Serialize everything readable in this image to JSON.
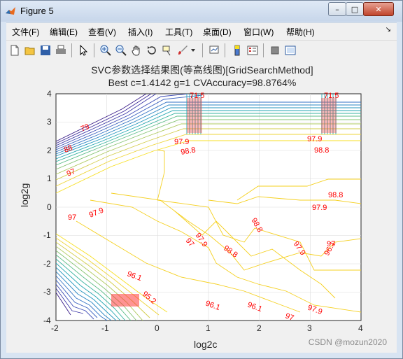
{
  "window": {
    "title": "Figure 5",
    "controls": {
      "minimize": "–",
      "maximize": "□",
      "close": "✕"
    }
  },
  "menu": {
    "items": [
      "文件(F)",
      "编辑(E)",
      "查看(V)",
      "插入(I)",
      "工具(T)",
      "桌面(D)",
      "窗口(W)",
      "帮助(H)"
    ],
    "overflow_arrow": "↘"
  },
  "toolbar": {
    "icons": [
      "new-figure-icon",
      "open-folder-icon",
      "save-icon",
      "print-icon",
      "pointer-icon",
      "zoom-in-icon",
      "zoom-out-icon",
      "pan-hand-icon",
      "rotate-3d-icon",
      "data-cursor-icon",
      "brush-icon",
      "dropdown-arrow-icon",
      "link-plot-icon",
      "colorbar-icon",
      "legend-icon",
      "hide-plot-tools-icon",
      "show-plot-tools-icon"
    ]
  },
  "colors": {
    "contour_low": "#3a1d89",
    "contour_mid": "#2a9ebc",
    "contour_high": "#f5dd1f",
    "label_red": "#ff0000"
  },
  "plot": {
    "title_line1": "SVC参数选择结果图(等高线图)[GridSearchMethod]",
    "title_line2": "Best c=1.4142 g=1 CVAccuracy=98.8764%",
    "xlabel": "log2c",
    "ylabel": "log2g",
    "xticks": [
      "-2",
      "-1",
      "0",
      "1",
      "2",
      "3",
      "4"
    ],
    "yticks": [
      "4",
      "3",
      "2",
      "1",
      "0",
      "-1",
      "-2",
      "-3",
      "-4"
    ]
  },
  "contour_labels": {
    "upper_left": [
      "88",
      "97",
      "79"
    ],
    "upper_mid": [
      "97.9",
      "98.8",
      "71.5"
    ],
    "upper_right": [
      "97.9",
      "98.8",
      "71.5"
    ],
    "mid": [
      "97",
      "98.8",
      "97.9",
      "98.8",
      "97",
      "97.9",
      "98.8",
      "97.9"
    ],
    "right": [
      "97",
      "96.1",
      "97.9"
    ],
    "lower": [
      "96.1",
      "95.2",
      "96.1",
      "96.1",
      "97",
      "97.9"
    ]
  },
  "chart_data": {
    "type": "contour",
    "title": "SVC参数选择结果图(等高线图)[GridSearchMethod]",
    "subtitle": "Best c=1.4142 g=1 CVAccuracy=98.8764%",
    "xlabel": "log2c",
    "ylabel": "log2g",
    "xlim": [
      -2,
      4
    ],
    "ylim": [
      -4,
      4
    ],
    "best": {
      "c": 1.4142,
      "g": 1,
      "cv_accuracy": 98.8764
    },
    "contour_levels_labeled": [
      71.5,
      79,
      88,
      95.2,
      96.1,
      97,
      97.9,
      98.8
    ],
    "grid": true
  },
  "watermark": "CSDN @mozun2020"
}
